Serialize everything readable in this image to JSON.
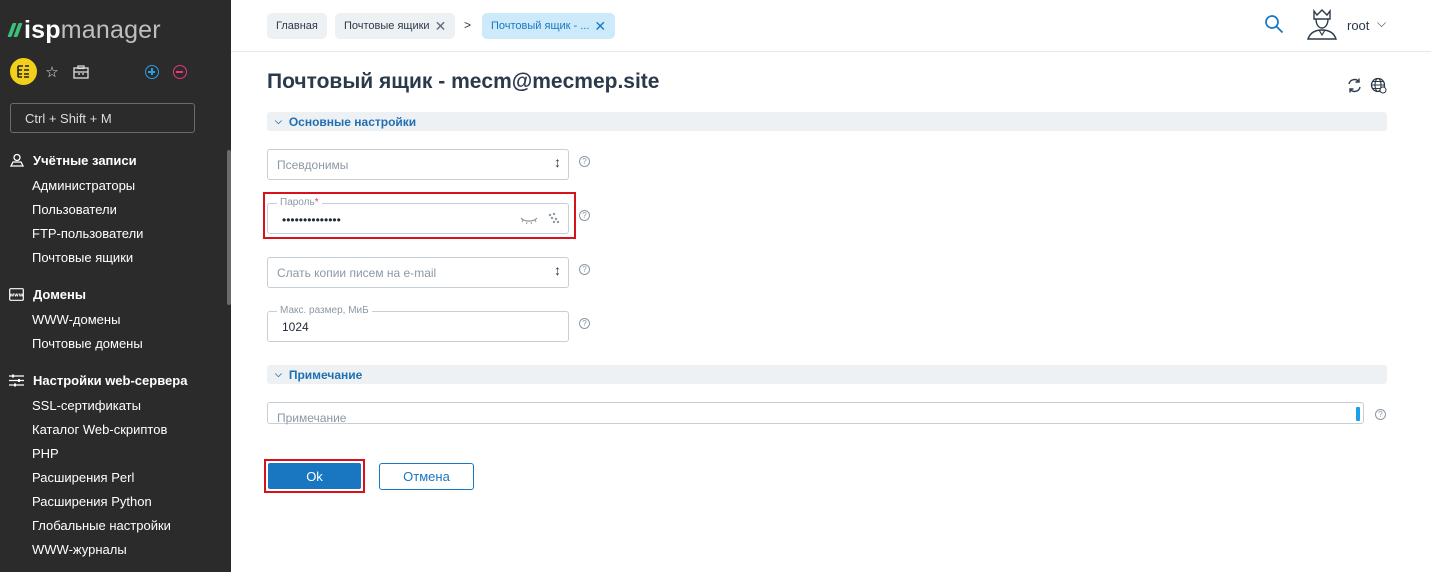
{
  "app": {
    "logo_isp": "isp",
    "logo_manager": "manager"
  },
  "sidebar": {
    "search_placeholder": "Ctrl + Shift + M",
    "groups": [
      {
        "title": "Учётные записи",
        "icon": "user-map-icon",
        "items": [
          "Администраторы",
          "Пользователи",
          "FTP-пользователи",
          "Почтовые ящики"
        ]
      },
      {
        "title": "Домены",
        "icon": "www-icon",
        "items": [
          "WWW-домены",
          "Почтовые домены"
        ]
      },
      {
        "title": "Настройки web-сервера",
        "icon": "sliders-icon",
        "items": [
          "SSL-сертификаты",
          "Каталог Web-скриптов",
          "PHP",
          "Расширения Perl",
          "Расширения Python",
          "Глобальные настройки",
          "WWW-журналы"
        ]
      }
    ]
  },
  "tabs": [
    {
      "label": "Главная"
    },
    {
      "label": "Почтовые ящики"
    },
    {
      "label": "Почтовый ящик - ..."
    }
  ],
  "tab_separator": ">",
  "user": {
    "name": "root",
    "chevron": "⌵"
  },
  "page": {
    "title": "Почтовый ящик - mecm@mecmep.site"
  },
  "sections": {
    "main_settings": "Основные настройки",
    "note": "Примечание"
  },
  "fields": {
    "aliases_placeholder": "Псевдонимы",
    "password_label": "Пароль",
    "password_required": "*",
    "password_value": "••••••••••••••",
    "copies_placeholder": "Слать копии писем на e-mail",
    "max_size_label": "Макс. размер, МиБ",
    "max_size_value": "1024",
    "note_placeholder": "Примечание"
  },
  "buttons": {
    "ok": "Ok",
    "cancel": "Отмена"
  },
  "colors": {
    "sidebar_bg": "#2b2b2b",
    "accent": "#1977c2",
    "highlight": "#d9111a",
    "logo_green": "#3bbf7a",
    "tree_icon_bg": "#f2cf1a"
  }
}
